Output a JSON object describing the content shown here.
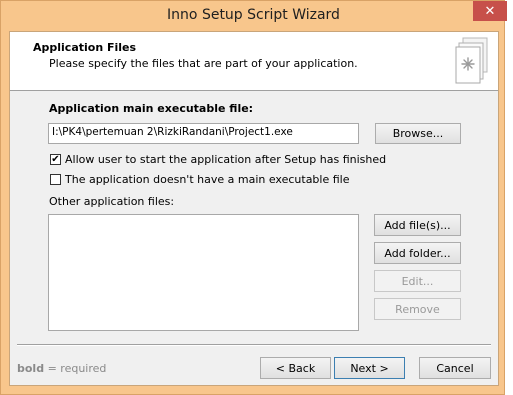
{
  "window": {
    "title": "Inno Setup Script Wizard",
    "close_glyph": "✕"
  },
  "header": {
    "title": "Application Files",
    "description": "Please specify the files that are part of your application."
  },
  "main_exe": {
    "label": "Application main executable file:",
    "value": "I:\\PK4\\pertemuan 2\\RizkiRandani\\Project1.exe",
    "browse_label": "Browse..."
  },
  "options": {
    "allow_start": {
      "label": "Allow user to start the application after Setup has finished",
      "checked": true
    },
    "no_main_exe": {
      "label": "The application doesn't have a main executable file",
      "checked": false
    }
  },
  "other_files": {
    "label": "Other application files:",
    "items": [],
    "add_files_label": "Add file(s)...",
    "add_folder_label": "Add folder...",
    "edit_label": "Edit...",
    "remove_label": "Remove"
  },
  "footer": {
    "hint_bold": "bold",
    "hint_rest": " = required",
    "back_label": "< Back",
    "next_label": "Next >",
    "cancel_label": "Cancel"
  },
  "colors": {
    "frame": "#f8c68c",
    "close_button": "#c7504a",
    "dialog_bg": "#f0f0f0"
  },
  "icons": {
    "header": "document-star-icon",
    "checkmark": "✔"
  }
}
